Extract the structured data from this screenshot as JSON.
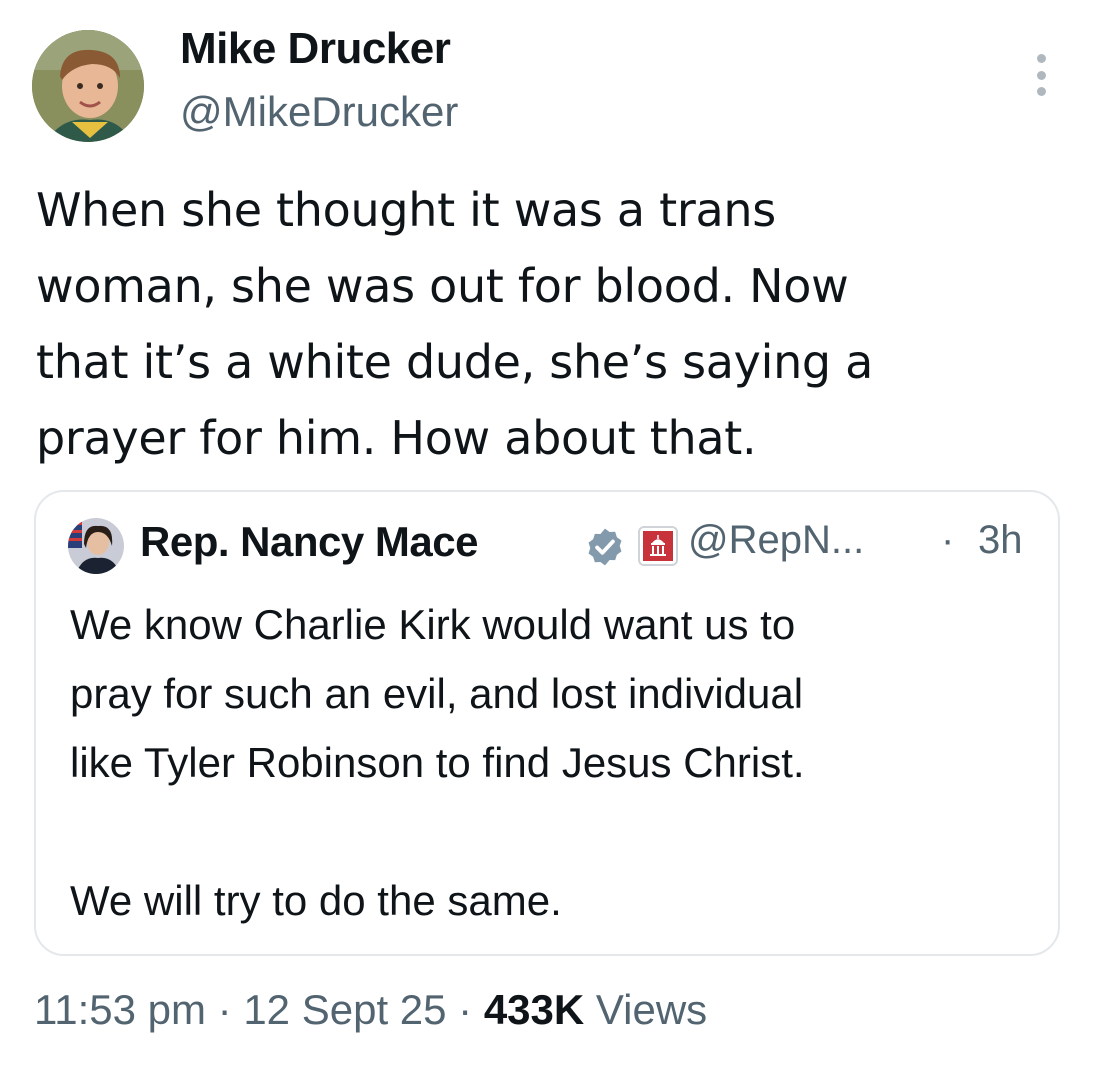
{
  "author": {
    "name": "Mike Drucker",
    "handle": "@MikeDrucker",
    "avatar_icon": "avatar-photo-child"
  },
  "more_icon": "more-vertical-icon",
  "tweet": {
    "text_lines": [
      "When she thought it was a trans",
      "woman, she was out for blood. Now",
      "that it’s a white dude, she’s saying a",
      "prayer for him. How about that."
    ]
  },
  "quote": {
    "name": "Rep. Nancy Mace",
    "verified_icon": "verified-badge-gray",
    "affiliate_icon": "us-house-affiliate-badge",
    "handle": "@RepN...",
    "separator": "·",
    "time": "3h",
    "text_lines": [
      "We know Charlie Kirk would want us to",
      "pray for such an evil, and lost individual",
      "like Tyler Robinson to find Jesus Christ."
    ],
    "text_last": "We will try to do the same."
  },
  "meta": {
    "time": "11:53 pm",
    "sep1": " · ",
    "date": "12 Sept 25",
    "sep2": " · ",
    "views_count": "433K",
    "views_label": " Views"
  },
  "colors": {
    "text": "#0f1419",
    "secondary": "#536471",
    "border": "#e4e8eb",
    "verified": "#829aab"
  }
}
